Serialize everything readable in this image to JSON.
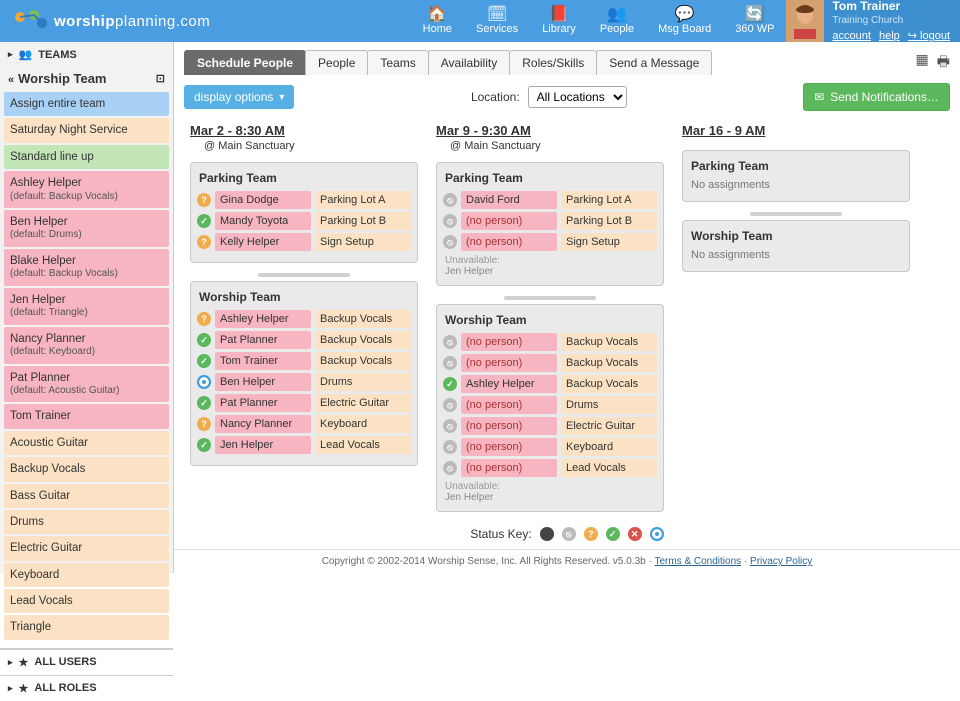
{
  "header": {
    "logo_a": "worship",
    "logo_b": "planning",
    "logo_c": ".com",
    "nav": [
      {
        "icon": "home",
        "label": "Home"
      },
      {
        "icon": "cal",
        "label": "Services"
      },
      {
        "icon": "book",
        "label": "Library"
      },
      {
        "icon": "people",
        "label": "People"
      },
      {
        "icon": "chat",
        "label": "Msg Board"
      },
      {
        "icon": "refresh",
        "label": "360 WP"
      }
    ],
    "user": {
      "name": "Tom Trainer",
      "org": "Training Church",
      "links": [
        "account",
        "help",
        "↪ logout"
      ]
    }
  },
  "sidebar": {
    "teams_label": "TEAMS",
    "current_team": "Worship Team",
    "items": [
      {
        "cls": "c-blue",
        "label": "Assign entire team"
      },
      {
        "cls": "c-peach",
        "label": "Saturday Night Service"
      },
      {
        "cls": "c-green",
        "label": "Standard line up"
      },
      {
        "cls": "c-pink",
        "label": "Ashley Helper",
        "sub": "(default: Backup Vocals)"
      },
      {
        "cls": "c-pink",
        "label": "Ben Helper",
        "sub": "(default: Drums)"
      },
      {
        "cls": "c-pink",
        "label": "Blake Helper",
        "sub": "(default: Backup Vocals)"
      },
      {
        "cls": "c-pink",
        "label": "Jen Helper",
        "sub": "(default: Triangle)"
      },
      {
        "cls": "c-pink",
        "label": "Nancy Planner",
        "sub": "(default: Keyboard)"
      },
      {
        "cls": "c-pink",
        "label": "Pat Planner",
        "sub": "(default: Acoustic Guitar)"
      },
      {
        "cls": "c-pink",
        "label": "Tom Trainer"
      },
      {
        "cls": "c-peach",
        "label": "Acoustic Guitar"
      },
      {
        "cls": "c-peach",
        "label": "Backup Vocals"
      },
      {
        "cls": "c-peach",
        "label": "Bass Guitar"
      },
      {
        "cls": "c-peach",
        "label": "Drums"
      },
      {
        "cls": "c-peach",
        "label": "Electric Guitar"
      },
      {
        "cls": "c-peach",
        "label": "Keyboard"
      },
      {
        "cls": "c-peach",
        "label": "Lead Vocals"
      },
      {
        "cls": "c-peach",
        "label": "Triangle"
      }
    ],
    "all_users": "ALL USERS",
    "all_roles": "ALL ROLES"
  },
  "tabs": [
    "Schedule People",
    "People",
    "Teams",
    "Availability",
    "Roles/Skills",
    "Send a Message"
  ],
  "display_options": "display options",
  "location_label": "Location:",
  "location_value": "All Locations",
  "send_notif": "Send Notifications…",
  "services": [
    {
      "title": "Mar 2 - 8:30 AM",
      "sub": "@ Main Sanctuary",
      "teams": [
        {
          "name": "Parking Team",
          "rows": [
            {
              "st": "q",
              "person": "Gina Dodge",
              "role": "Parking Lot A"
            },
            {
              "st": "y",
              "person": "Mandy Toyota",
              "role": "Parking Lot B"
            },
            {
              "st": "q",
              "person": "Kelly Helper",
              "role": "Sign Setup"
            }
          ]
        },
        {
          "name": "Worship Team",
          "rows": [
            {
              "st": "q",
              "person": "Ashley Helper",
              "role": "Backup Vocals"
            },
            {
              "st": "y",
              "person": "Pat Planner",
              "role": "Backup Vocals"
            },
            {
              "st": "y",
              "person": "Tom Trainer",
              "role": "Backup Vocals"
            },
            {
              "st": "o",
              "person": "Ben Helper",
              "role": "Drums"
            },
            {
              "st": "y",
              "person": "Pat Planner",
              "role": "Electric Guitar"
            },
            {
              "st": "q",
              "person": "Nancy Planner",
              "role": "Keyboard"
            },
            {
              "st": "y",
              "person": "Jen Helper",
              "role": "Lead Vocals"
            }
          ]
        }
      ]
    },
    {
      "title": "Mar 9 - 9:30 AM",
      "sub": "@ Main Sanctuary",
      "teams": [
        {
          "name": "Parking Team",
          "rows": [
            {
              "st": "g",
              "person": "David Ford",
              "role": "Parking Lot A"
            },
            {
              "st": "g",
              "person": "(no person)",
              "role": "Parking Lot B",
              "np": true
            },
            {
              "st": "g",
              "person": "(no person)",
              "role": "Sign Setup",
              "np": true
            }
          ],
          "unavail": "Jen Helper"
        },
        {
          "name": "Worship Team",
          "rows": [
            {
              "st": "g",
              "person": "(no person)",
              "role": "Backup Vocals",
              "np": true
            },
            {
              "st": "g",
              "person": "(no person)",
              "role": "Backup Vocals",
              "np": true
            },
            {
              "st": "y",
              "person": "Ashley Helper",
              "role": "Backup Vocals"
            },
            {
              "st": "g",
              "person": "(no person)",
              "role": "Drums",
              "np": true
            },
            {
              "st": "g",
              "person": "(no person)",
              "role": "Electric Guitar",
              "np": true
            },
            {
              "st": "g",
              "person": "(no person)",
              "role": "Keyboard",
              "np": true
            },
            {
              "st": "g",
              "person": "(no person)",
              "role": "Lead Vocals",
              "np": true
            }
          ],
          "unavail": "Jen Helper"
        }
      ]
    },
    {
      "title": "Mar 16 - 9 AM",
      "sub": "",
      "teams": [
        {
          "name": "Parking Team",
          "empty": "No assignments"
        },
        {
          "name": "Worship Team",
          "empty": "No assignments"
        }
      ]
    }
  ],
  "status_key_label": "Status Key:",
  "unavailable_label": "Unavailable:",
  "footer": {
    "copy": "Copyright © 2002-2014 Worship Sense, Inc. All Rights Reserved. v5.0.3b",
    "terms": "Terms & Conditions",
    "privacy": "Privacy Policy"
  }
}
